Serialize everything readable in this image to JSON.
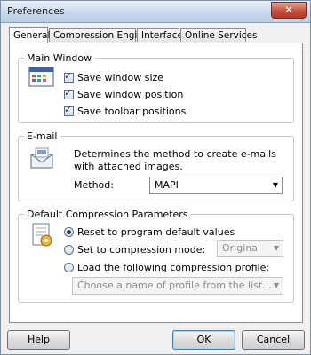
{
  "window": {
    "title": "Preferences",
    "close_glyph": "✕"
  },
  "tabs": [
    {
      "label": "General",
      "active": true
    },
    {
      "label": "Compression Engine",
      "active": false
    },
    {
      "label": "Interface",
      "active": false
    },
    {
      "label": "Online Services",
      "active": false
    }
  ],
  "main_window": {
    "legend": "Main Window",
    "icon": "window-icon",
    "options": [
      {
        "label": "Save window size",
        "checked": true
      },
      {
        "label": "Save window position",
        "checked": true
      },
      {
        "label": "Save toolbar positions",
        "checked": true
      }
    ]
  },
  "email": {
    "legend": "E-mail",
    "icon": "envelope-icon",
    "description": "Determines the method to create e-mails with attached images.",
    "method_label": "Method:",
    "method_value": "MAPI"
  },
  "compression": {
    "legend": "Default Compression Parameters",
    "icon": "settings-document-icon",
    "options": [
      {
        "label": "Reset to program default values",
        "selected": true
      },
      {
        "label": "Set to compression mode:",
        "selected": false
      },
      {
        "label": "Load the following compression profile:",
        "selected": false
      }
    ],
    "mode_value": "Original",
    "profile_placeholder": "Choose a name of profile from the list..."
  },
  "buttons": {
    "help": "Help",
    "ok": "OK",
    "cancel": "Cancel"
  },
  "colors": {
    "accent": "#3c7fb1",
    "close": "#c7503a"
  }
}
